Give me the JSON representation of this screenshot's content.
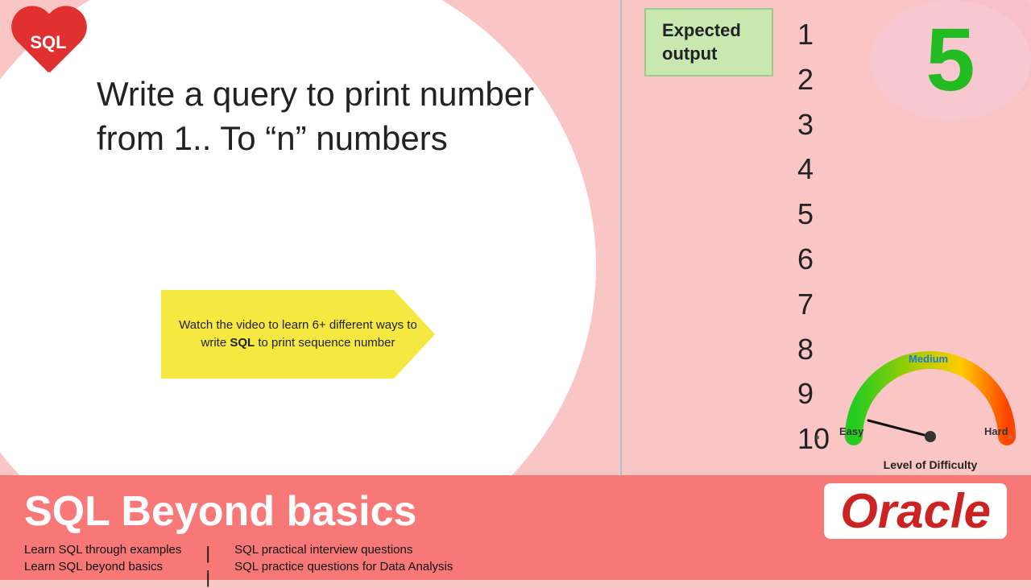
{
  "background_color": "#f9c5c5",
  "heart_badge": {
    "label": "SQL",
    "bg_color": "#e03030"
  },
  "question": {
    "text": "Write a query to print number from 1.. To “n” numbers"
  },
  "arrow_box": {
    "text": "Watch the video to learn 6+ different ways to write",
    "bold_word": "SQL",
    "text2": "to print sequence number"
  },
  "expected_output": {
    "label": "Expected output",
    "numbers": [
      "1",
      "2",
      "3",
      "4",
      "5",
      "6",
      "7",
      "8",
      "9",
      "10"
    ],
    "dots": [
      ".",
      ".",
      "."
    ]
  },
  "difficulty_badge": {
    "number": "5"
  },
  "gauge": {
    "easy_label": "Easy",
    "medium_label": "Medium",
    "hard_label": "Hard",
    "level_label": "Level of Difficulty"
  },
  "bottom": {
    "title": "SQL Beyond basics",
    "oracle": "Oracle",
    "links": [
      "Learn SQL through examples",
      "Learn SQL beyond basics"
    ],
    "separator": "|",
    "right_links": [
      "SQL practical interview questions",
      "SQL practice questions for Data Analysis"
    ]
  }
}
